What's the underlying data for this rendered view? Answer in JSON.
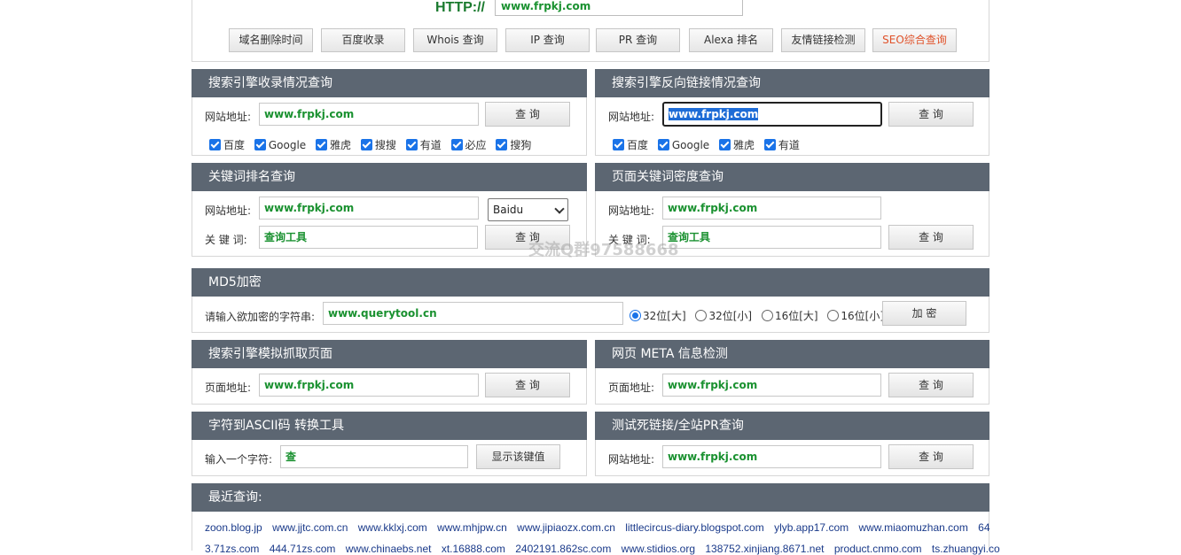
{
  "top": {
    "http_label": "HTTP://",
    "http_value": "www.frpkj.com",
    "buttons": [
      "域名删除时间",
      "百度收录",
      "Whois 查询",
      "IP 查询",
      "PR 查询",
      "Alexa 排名",
      "友情链接检测",
      "SEO综合查询"
    ]
  },
  "index_query": {
    "title": "搜索引擎收录情况查询",
    "label": "网站地址:",
    "value": "www.frpkj.com",
    "button": "查 询",
    "checks": [
      "百度",
      "Google",
      "雅虎",
      "搜搜",
      "有道",
      "必应",
      "搜狗"
    ]
  },
  "backlink_query": {
    "title": "搜索引擎反向链接情况查询",
    "label": "网站地址:",
    "value": "www.frpkj.com",
    "button": "查 询",
    "checks": [
      "百度",
      "Google",
      "雅虎",
      "有道"
    ]
  },
  "keyword_rank": {
    "title": "关键词排名查询",
    "site_label": "网站地址:",
    "site_value": "www.frpkj.com",
    "engine_selected": "Baidu",
    "kw_label": "关 键 词:",
    "kw_value": "查询工具",
    "button": "查 询"
  },
  "keyword_density": {
    "title": "页面关键词密度查询",
    "site_label": "网站地址:",
    "site_value": "www.frpkj.com",
    "kw_label": "关 键 词:",
    "kw_value": "查询工具",
    "button": "查 询"
  },
  "watermark": "交流Q群97588668",
  "md5": {
    "title": "MD5加密",
    "label": "请输入欲加密的字符串:",
    "value": "www.querytool.cn",
    "options": [
      "32位[大]",
      "32位[小]",
      "16位[大]",
      "16位[小]"
    ],
    "button": "加 密"
  },
  "spider": {
    "title": "搜索引擎模拟抓取页面",
    "label": "页面地址:",
    "value": "www.frpkj.com",
    "button": "查 询"
  },
  "meta": {
    "title": "网页 META 信息检测",
    "label": "页面地址:",
    "value": "www.frpkj.com",
    "button": "查 询"
  },
  "ascii": {
    "title": "字符到ASCII码 转换工具",
    "label": "输入一个字符:",
    "value": "查",
    "button": "显示该键值"
  },
  "deadlink": {
    "title": "测试死链接/全站PR查询",
    "label": "网站地址:",
    "value": "www.frpkj.com",
    "button": "查 询"
  },
  "recent": {
    "title": "最近查询:",
    "row1": [
      "zoon.blog.jp",
      "www.jjtc.com.cn",
      "www.kklxj.com",
      "www.mhjpw.cn",
      "www.jipiaozx.com.cn",
      "littlecircus-diary.blogspot.com",
      "ylyb.app17.com",
      "www.miaomuzhan.com",
      "64"
    ],
    "row2": [
      "3.71zs.com",
      "444.71zs.com",
      "www.chinaebs.net",
      "xt.16888.com",
      "2402191.862sc.com",
      "www.stidios.org",
      "138752.xinjiang.8671.net",
      "product.cnmo.com",
      "ts.zhuangyi.co"
    ]
  }
}
